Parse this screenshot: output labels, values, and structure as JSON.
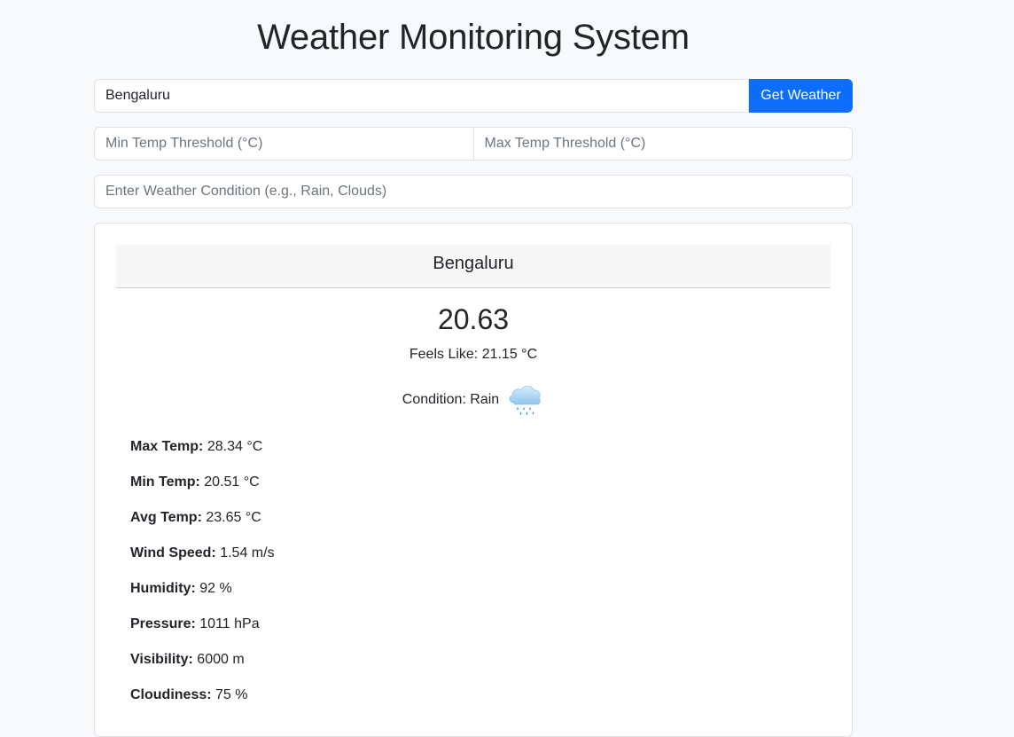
{
  "header": {
    "title": "Weather Monitoring System"
  },
  "search": {
    "city_value": "Bengaluru",
    "button_label": "Get Weather"
  },
  "thresholds": {
    "min_placeholder": "Min Temp Threshold (°C)",
    "max_placeholder": "Max Temp Threshold (°C)"
  },
  "condition_filter": {
    "placeholder": "Enter Weather Condition (e.g., Rain, Clouds)"
  },
  "card": {
    "city": "Bengaluru",
    "temperature": "20.63",
    "feels_like": "Feels Like: 21.15 °C",
    "condition_label": "Condition:",
    "condition_value": "Rain",
    "condition_icon": "rain-cloud-icon",
    "stats": [
      {
        "label": "Max Temp:",
        "value": "28.34 °C"
      },
      {
        "label": "Min Temp:",
        "value": "20.51 °C"
      },
      {
        "label": "Avg Temp:",
        "value": "23.65 °C"
      },
      {
        "label": "Wind Speed:",
        "value": "1.54 m/s"
      },
      {
        "label": "Humidity:",
        "value": "92 %"
      },
      {
        "label": "Pressure:",
        "value": "1011 hPa"
      },
      {
        "label": "Visibility:",
        "value": "6000 m"
      },
      {
        "label": "Cloudiness:",
        "value": "75 %"
      }
    ]
  },
  "colors": {
    "primary": "#0d6efd",
    "page_background": "#f8f9fa",
    "card_header_background": "#f7f7f7"
  }
}
